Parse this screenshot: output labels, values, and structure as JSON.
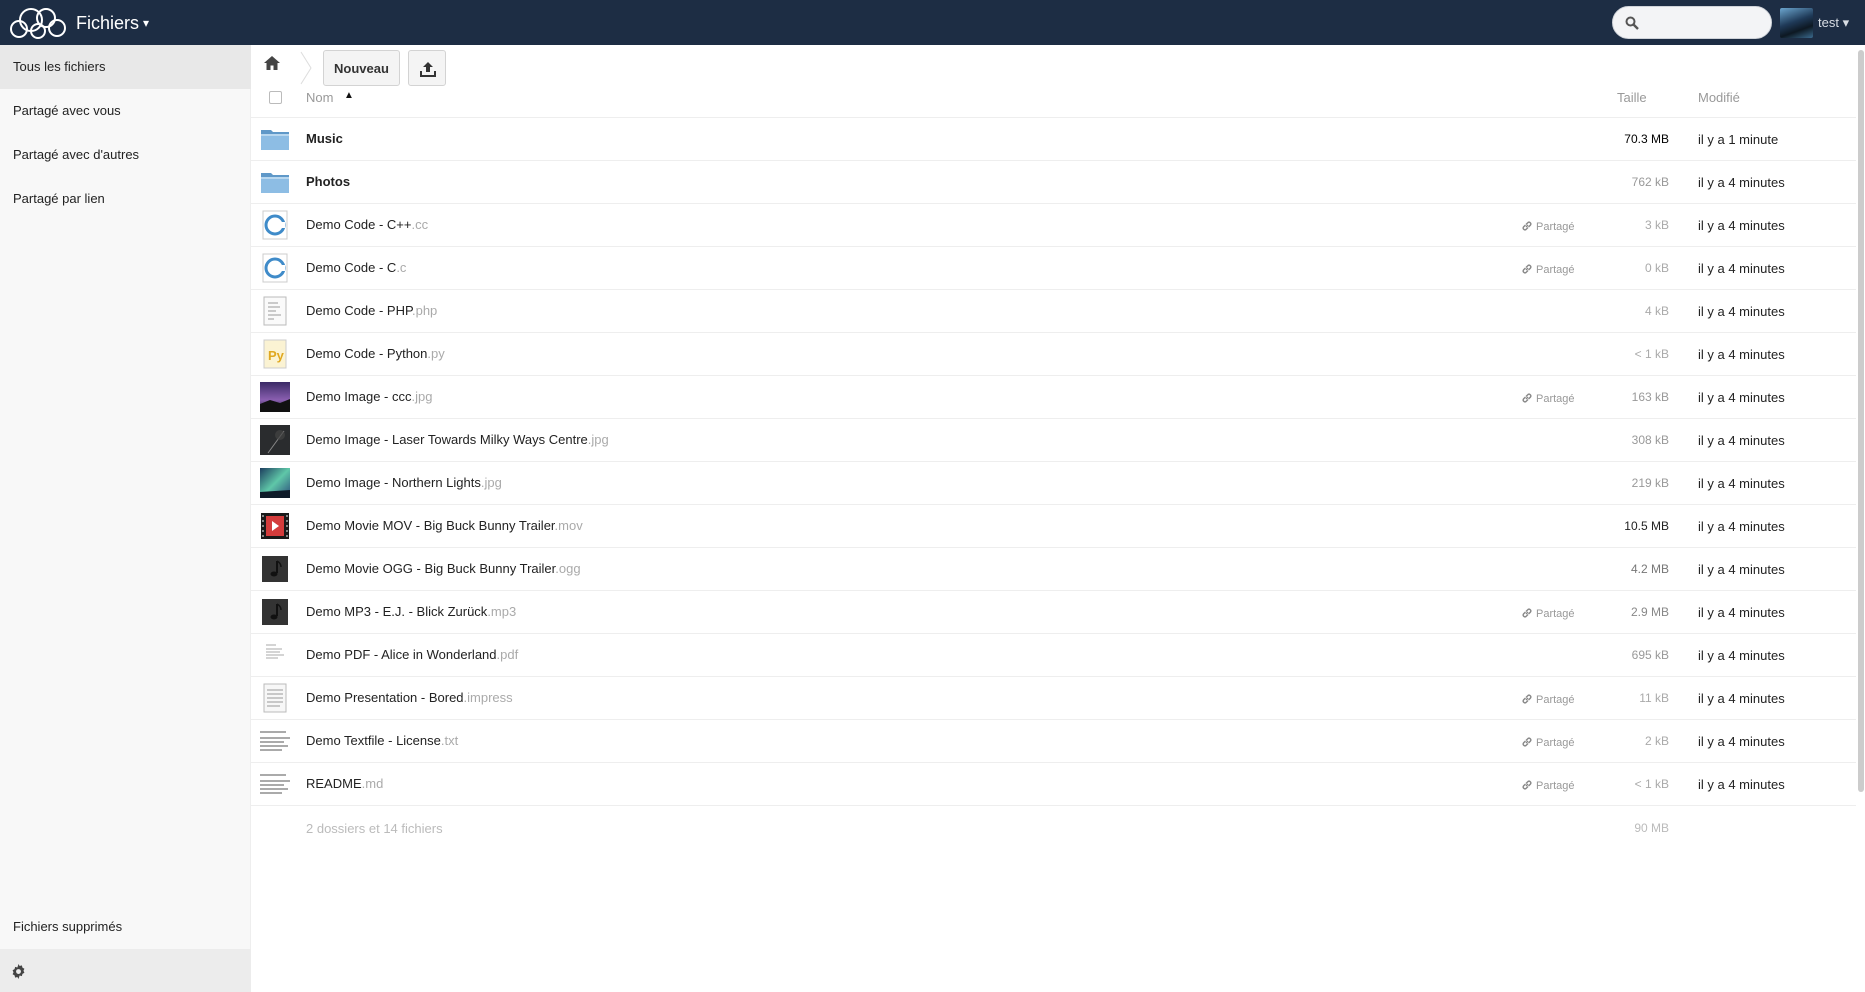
{
  "header": {
    "app_title": "Fichiers",
    "caret": "▾",
    "search": {
      "placeholder": "",
      "value": ""
    },
    "user": {
      "name": "test ▾"
    },
    "colors": {
      "header_bg": "#1d2d44"
    }
  },
  "sidebar": {
    "items": [
      {
        "label": "Tous les fichiers",
        "active": true
      },
      {
        "label": "Partagé avec vous",
        "active": false
      },
      {
        "label": "Partagé avec d'autres",
        "active": false
      },
      {
        "label": "Partagé par lien",
        "active": false
      }
    ],
    "deleted_label": "Fichiers supprimés",
    "settings_icon": "gear-icon"
  },
  "controls": {
    "home_icon": "home-icon",
    "new_label": "Nouveau",
    "upload_icon": "upload-icon"
  },
  "table": {
    "headers": {
      "name": "Nom",
      "sort_arrow": "▲",
      "size": "Taille",
      "modified": "Modifié"
    },
    "rows": [
      {
        "name": "Music",
        "ext": "",
        "type": "folder",
        "shared": "",
        "size": "70.3 MB",
        "size_color": "#000",
        "modified": "il y a 1 minute",
        "bold": true
      },
      {
        "name": "Photos",
        "ext": "",
        "type": "folder",
        "shared": "",
        "size": "762 kB",
        "size_color": "#999",
        "modified": "il y a 4 minutes",
        "bold": true
      },
      {
        "name": "Demo Code - C++",
        "ext": ".cc",
        "type": "code-c",
        "shared": "Partagé",
        "size": "3 kB",
        "size_color": "#aaa",
        "modified": "il y a 4 minutes"
      },
      {
        "name": "Demo Code - C",
        "ext": ".c",
        "type": "code-c",
        "shared": "Partagé",
        "size": "0 kB",
        "size_color": "#aaa",
        "modified": "il y a 4 minutes"
      },
      {
        "name": "Demo Code - PHP",
        "ext": ".php",
        "type": "code-php",
        "shared": "",
        "size": "4 kB",
        "size_color": "#aaa",
        "modified": "il y a 4 minutes"
      },
      {
        "name": "Demo Code - Python",
        "ext": ".py",
        "type": "code-python",
        "shared": "",
        "size": "< 1 kB",
        "size_color": "#aaa",
        "modified": "il y a 4 minutes"
      },
      {
        "name": "Demo Image - ccc",
        "ext": ".jpg",
        "type": "image-ccc",
        "shared": "Partagé",
        "size": "163 kB",
        "size_color": "#999",
        "modified": "il y a 4 minutes"
      },
      {
        "name": "Demo Image - Laser Towards Milky Ways Centre",
        "ext": ".jpg",
        "type": "image-laser",
        "shared": "",
        "size": "308 kB",
        "size_color": "#999",
        "modified": "il y a 4 minutes"
      },
      {
        "name": "Demo Image - Northern Lights",
        "ext": ".jpg",
        "type": "image-aurora",
        "shared": "",
        "size": "219 kB",
        "size_color": "#999",
        "modified": "il y a 4 minutes"
      },
      {
        "name": "Demo Movie MOV - Big Buck Bunny Trailer",
        "ext": ".mov",
        "type": "movie",
        "shared": "",
        "size": "10.5 MB",
        "size_color": "#222",
        "modified": "il y a 4 minutes"
      },
      {
        "name": "Demo Movie OGG - Big Buck Bunny Trailer",
        "ext": ".ogg",
        "type": "audio",
        "shared": "",
        "size": "4.2 MB",
        "size_color": "#777",
        "modified": "il y a 4 minutes"
      },
      {
        "name": "Demo MP3 - E.J. - Blick Zurück",
        "ext": ".mp3",
        "type": "audio",
        "shared": "Partagé",
        "size": "2.9 MB",
        "size_color": "#888",
        "modified": "il y a 4 minutes"
      },
      {
        "name": "Demo PDF - Alice in Wonderland",
        "ext": ".pdf",
        "type": "pdf",
        "shared": "",
        "size": "695 kB",
        "size_color": "#999",
        "modified": "il y a 4 minutes"
      },
      {
        "name": "Demo Presentation - Bored",
        "ext": ".impress",
        "type": "document",
        "shared": "Partagé",
        "size": "11 kB",
        "size_color": "#aaa",
        "modified": "il y a 4 minutes"
      },
      {
        "name": "Demo Textfile - License",
        "ext": ".txt",
        "type": "text",
        "shared": "Partagé",
        "size": "2 kB",
        "size_color": "#aaa",
        "modified": "il y a 4 minutes"
      },
      {
        "name": "README",
        "ext": ".md",
        "type": "text",
        "shared": "Partagé",
        "size": "< 1 kB",
        "size_color": "#aaa",
        "modified": "il y a 4 minutes"
      }
    ],
    "summary": {
      "text": "2 dossiers et 14 fichiers",
      "size": "90 MB"
    }
  }
}
